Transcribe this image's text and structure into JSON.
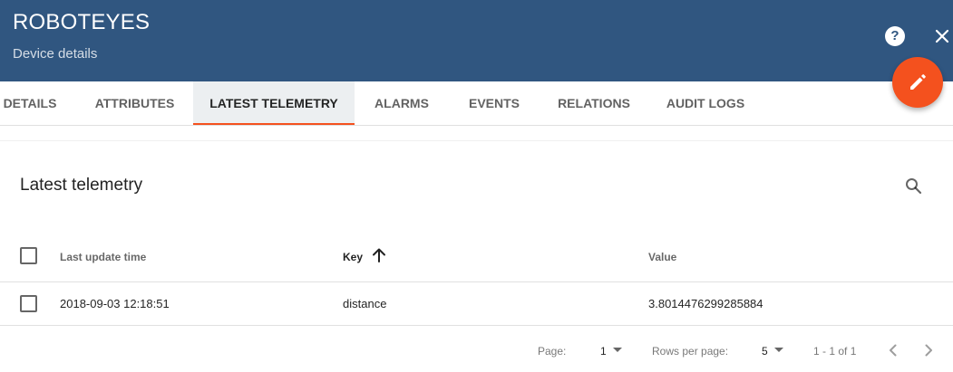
{
  "header": {
    "title": "ROBOTEYES",
    "subtitle": "Device details",
    "help_icon": "help-circle-icon",
    "close_icon": "close-icon",
    "edit_icon": "pencil-icon",
    "background": "#305680",
    "fab_color": "#f4511e"
  },
  "tabs": [
    {
      "label": "DETAILS",
      "active": false
    },
    {
      "label": "ATTRIBUTES",
      "active": false
    },
    {
      "label": "LATEST TELEMETRY",
      "active": true
    },
    {
      "label": "ALARMS",
      "active": false
    },
    {
      "label": "EVENTS",
      "active": false
    },
    {
      "label": "RELATIONS",
      "active": false
    },
    {
      "label": "AUDIT LOGS",
      "active": false
    }
  ],
  "card": {
    "title": "Latest telemetry",
    "search_icon": "search-icon"
  },
  "table": {
    "columns": [
      {
        "label": "Last update time"
      },
      {
        "label": "Key",
        "sort": "ascending"
      },
      {
        "label": "Value"
      }
    ],
    "rows": [
      {
        "time": "2018-09-03 12:18:51",
        "key": "distance",
        "value": "3.8014476299285884",
        "selected": false
      }
    ]
  },
  "pagination": {
    "page_label": "Page:",
    "page_value": "1",
    "rows_label": "Rows per page:",
    "rows_value": "5",
    "range": "1 - 1 of 1",
    "prev_icon": "chevron-left-icon",
    "next_icon": "chevron-right-icon"
  }
}
